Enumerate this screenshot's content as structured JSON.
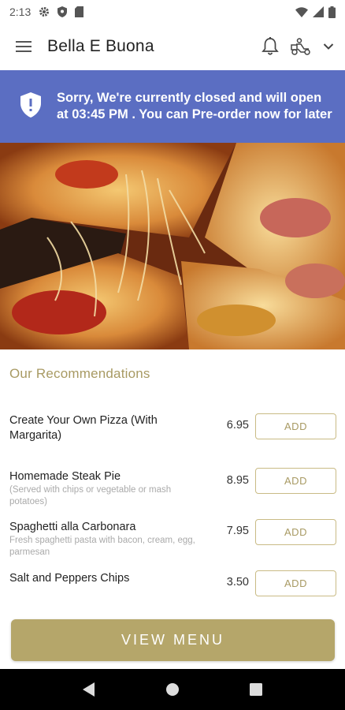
{
  "status_bar": {
    "time": "2:13",
    "icons": [
      "gear-icon",
      "shield-icon",
      "sd-card-icon",
      "wifi-icon",
      "signal-icon",
      "battery-icon"
    ]
  },
  "app_bar": {
    "title": "Bella E Buona",
    "icons": [
      "hamburger-menu-icon",
      "bell-icon",
      "delivery-person-icon",
      "chevron-down-icon"
    ]
  },
  "banner": {
    "message": "Sorry, We're currently closed and will open at 03:45 PM . You can Pre-order now for later",
    "icon": "shield-alert-icon",
    "color": "#5b6ec2"
  },
  "recommendations": {
    "title": "Our Recommendations",
    "items": [
      {
        "name": "Create Your Own Pizza (With Margarita)",
        "description": "",
        "price": "6.95",
        "button": "ADD"
      },
      {
        "name": "Homemade Steak Pie",
        "description": "(Served with chips or vegetable or mash potatoes)",
        "price": "8.95",
        "button": "ADD"
      },
      {
        "name": "Spaghetti alla Carbonara",
        "description": "Fresh spaghetti pasta with bacon, cream, egg, parmesan",
        "price": "7.95",
        "button": "ADD"
      },
      {
        "name": "Salt and Peppers Chips",
        "description": "",
        "price": "3.50",
        "button": "ADD"
      }
    ]
  },
  "view_menu": {
    "label": "VIEW MENU"
  },
  "colors": {
    "accent_gold": "#b5a66a",
    "banner_blue": "#5b6ec2"
  },
  "nav": {
    "icons": [
      "back-icon",
      "home-icon",
      "recents-icon"
    ]
  }
}
